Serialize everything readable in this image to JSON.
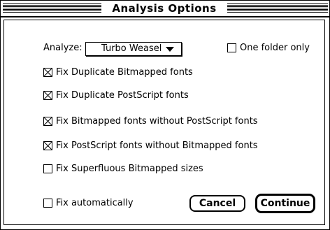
{
  "dialog": {
    "title": "Analysis Options",
    "analyze_label": "Analyze:",
    "analyze_value": "Turbo Weasel",
    "one_folder_only": {
      "label": "One folder only",
      "checked": false
    },
    "options": [
      {
        "label": "Fix Duplicate Bitmapped fonts",
        "checked": true
      },
      {
        "label": "Fix Duplicate PostScript fonts",
        "checked": true
      },
      {
        "label": "Fix Bitmapped fonts without PostScript fonts",
        "checked": true
      },
      {
        "label": "Fix PostScript fonts without Bitmapped fonts",
        "checked": true
      },
      {
        "label": "Fix Superfluous Bitmapped sizes",
        "checked": false
      }
    ],
    "fix_automatically": {
      "label": "Fix automatically",
      "checked": false
    },
    "cancel_label": "Cancel",
    "continue_label": "Continue"
  }
}
